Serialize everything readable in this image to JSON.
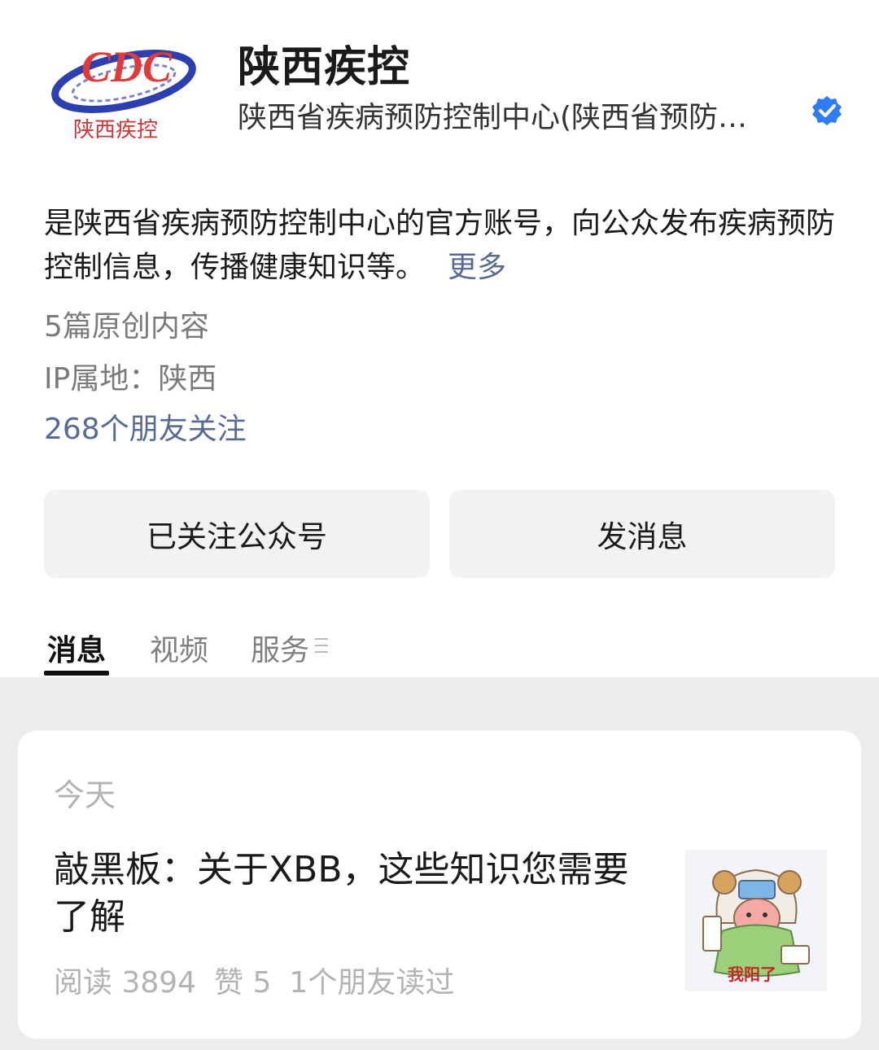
{
  "profile": {
    "name": "陕西疾控",
    "org": "陕西省疾病预防控制中心(陕西省预防…",
    "logo_caption": "陕西疾控",
    "logo_letters": "CDC"
  },
  "description": {
    "text": "是陕西省疾病预防控制中心的官方账号，向公众发布疾病预防控制信息，传播健康知识等。",
    "more": "更多"
  },
  "meta": {
    "original_count": "5篇原创内容",
    "ip": "IP属地：陕西",
    "friends_follow": "268个朋友关注"
  },
  "actions": {
    "followed": "已关注公众号",
    "message": "发消息"
  },
  "tabs": [
    "消息",
    "视频",
    "服务"
  ],
  "feed": {
    "date": "今天",
    "article": {
      "title": "敲黑板：关于XBB，这些知识您需要了解",
      "reads": "阅读 3894",
      "likes": "赞 5",
      "friends_read": "1个朋友读过",
      "thumb_caption": "我阳了"
    }
  },
  "colors": {
    "link": "#576b95",
    "verified": "#2f7cf6",
    "button_bg": "#f2f2f2",
    "feed_bg": "#ededed"
  },
  "icons": {
    "verified": "verified-badge-icon",
    "service_menu": "menu-lines-icon"
  }
}
